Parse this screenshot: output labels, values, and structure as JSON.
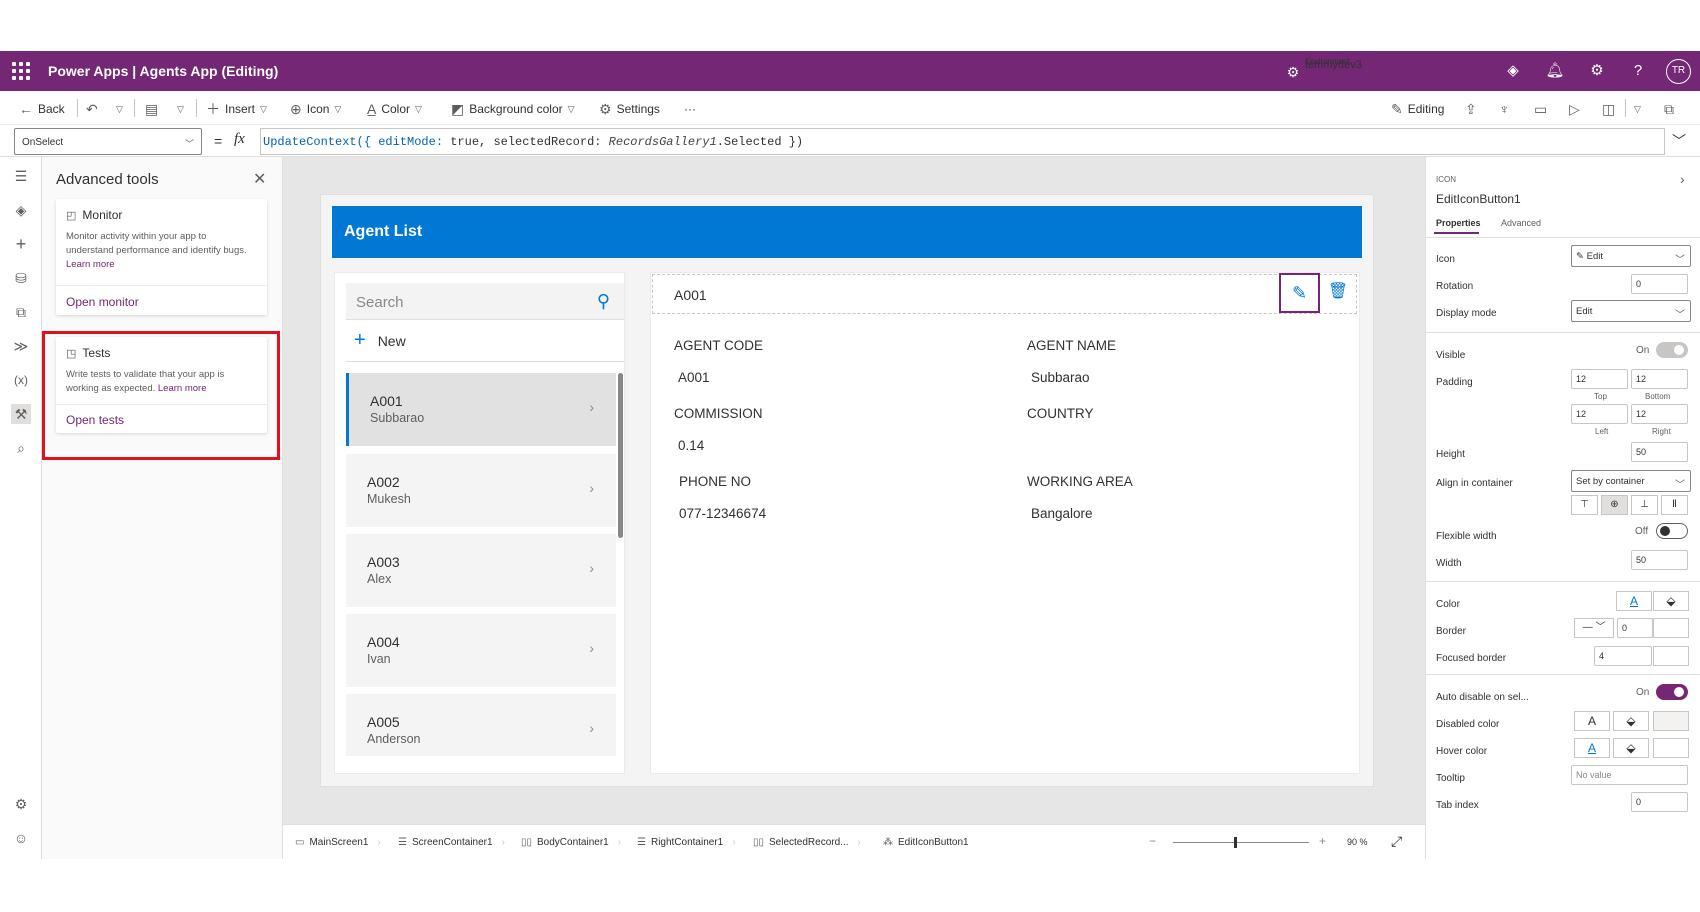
{
  "titlebar": {
    "app_name": "Power Apps  |  Agents App (Editing)",
    "environment_label": "Environment",
    "environment_name": "temmydev3",
    "avatar_initials": "TR"
  },
  "commandbar": {
    "back": "Back",
    "insert": "Insert",
    "icon": "Icon",
    "color": "Color",
    "background_color": "Background color",
    "settings": "Settings",
    "more": "···",
    "editing": "Editing"
  },
  "formulabar": {
    "property": "OnSelect",
    "eq": "=",
    "fx": "fx",
    "formula_parts": {
      "p1": "UpdateContext({ editMode: ",
      "p2": "true",
      "p3": ", selectedRecord: ",
      "p4": "RecordsGallery1",
      "p5": ".Selected })"
    }
  },
  "advanced_tools": {
    "title": "Advanced tools",
    "monitor": {
      "title": "Monitor",
      "desc": "Monitor activity within your app to understand performance and identify bugs.",
      "learn_more": "Learn more",
      "action": "Open monitor"
    },
    "tests": {
      "title": "Tests",
      "desc": "Write tests to validate that your app is working as expected.",
      "learn_more": "Learn more",
      "action": "Open tests"
    }
  },
  "app": {
    "header_title": "Agent List",
    "search_placeholder": "Search",
    "new_label": "New",
    "records": [
      {
        "code": "A001",
        "name": "Subbarao"
      },
      {
        "code": "A002",
        "name": "Mukesh"
      },
      {
        "code": "A003",
        "name": "Alex"
      },
      {
        "code": "A004",
        "name": "Ivan"
      },
      {
        "code": "A005",
        "name": "Anderson"
      }
    ],
    "selected_index": 0,
    "detail": {
      "code_value": "A001",
      "agent_code_label": "AGENT CODE",
      "agent_code": "A001",
      "agent_name_label": "AGENT NAME",
      "agent_name": "Subbarao",
      "commission_label": "COMMISSION",
      "commission": "0.14",
      "country_label": "COUNTRY",
      "country": "",
      "phone_label": "PHONE NO",
      "phone": "077-12346674",
      "working_area_label": "WORKING AREA",
      "working_area": "Bangalore"
    }
  },
  "properties": {
    "type": "ICON",
    "control_name": "EditIconButton1",
    "tab_properties": "Properties",
    "tab_advanced": "Advanced",
    "icon_label": "Icon",
    "icon_value": "Edit",
    "rotation_label": "Rotation",
    "rotation_value": "0",
    "display_mode_label": "Display mode",
    "display_mode_value": "Edit",
    "visible_label": "Visible",
    "visible_value": "On",
    "padding_label": "Padding",
    "padding_top": "12",
    "padding_bottom": "12",
    "padding_left": "12",
    "padding_right": "12",
    "top": "Top",
    "bottom": "Bottom",
    "left": "Left",
    "right": "Right",
    "height_label": "Height",
    "height_value": "50",
    "align_label": "Align in container",
    "align_value": "Set by container",
    "flexible_width_label": "Flexible width",
    "flexible_width_value": "Off",
    "width_label": "Width",
    "width_value": "50",
    "color_label": "Color",
    "border_label": "Border",
    "border_value": "0",
    "focused_border_label": "Focused border",
    "focused_border_value": "4",
    "auto_disable_label": "Auto disable on sel...",
    "auto_disable_value": "On",
    "disabled_color_label": "Disabled color",
    "hover_color_label": "Hover color",
    "tooltip_label": "Tooltip",
    "tooltip_placeholder": "No value",
    "tab_index_label": "Tab index",
    "tab_index_value": "0"
  },
  "statusbar": {
    "crumbs": [
      "MainScreen1",
      "ScreenContainer1",
      "BodyContainer1",
      "RightContainer1",
      "SelectedRecord...",
      "EditIconButton1"
    ],
    "zoom": "90",
    "zoom_unit": "%",
    "zoom_level": 0.45
  },
  "colors": {
    "brand": "#742774",
    "accent": "#0078d4",
    "highlight": "#e0101e"
  }
}
